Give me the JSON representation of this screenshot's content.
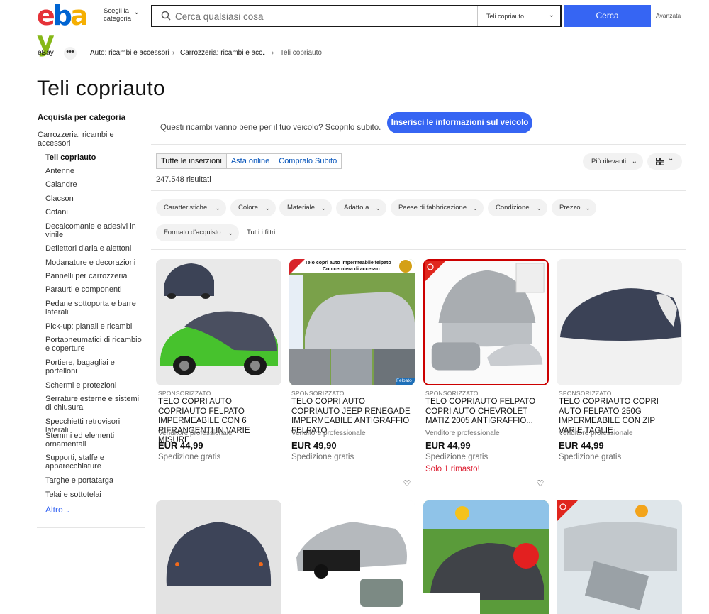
{
  "header": {
    "logo": [
      "e",
      "b",
      "a",
      "y"
    ],
    "category_select": "Scegli la categoria",
    "search_placeholder": "Cerca qualsiasi cosa",
    "search_category": "Teli copriauto",
    "search_button": "Cerca",
    "advanced": "Avanzata"
  },
  "breadcrumb": [
    "eBay",
    "•••",
    "Auto: ricambi e accessori",
    "Carrozzeria: ricambi e acc...",
    "Teli copriauto"
  ],
  "page_title": "Teli copriauto",
  "sidebar": {
    "heading": "Acquista per categoria",
    "parent": "Carrozzeria: ricambi e accessori",
    "items": [
      "Teli copriauto",
      "Antenne",
      "Calandre",
      "Clacson",
      "Cofani",
      "Decalcomanie e adesivi in vinile",
      "Deflettori d'aria e alettoni",
      "Modanature e decorazioni",
      "Pannelli per carrozzeria",
      "Paraurti e componenti",
      "Pedane sottoporta e barre laterali",
      "Pick-up: pianali e ricambi",
      "Portapneumatici di ricambio e coperture",
      "Portiere, bagagliai e portelloni",
      "Schermi e protezioni",
      "Serrature esterne e sistemi di chiusura",
      "Specchietti retrovisori laterali",
      "Stemmi ed elementi ornamentali",
      "Supporti, staffe e apparecchiature",
      "Targhe e portatarga",
      "Telai e sottotelai"
    ],
    "more": "Altro"
  },
  "vehicle": {
    "question": "Questi ricambi vanno bene per il tuo veicolo? Scoprilo subito.",
    "button": "Inserisci le informazioni sul veicolo"
  },
  "tabs": [
    "Tutte le inserzioni",
    "Asta online",
    "Compralo Subito"
  ],
  "results": "247.548 risultati",
  "sort": "Più rilevanti",
  "filters": [
    "Caratteristiche",
    "Colore",
    "Materiale",
    "Adatto a",
    "Paese di fabbricazione",
    "Condizione",
    "Prezzo",
    "Formato d'acquisto"
  ],
  "all_filters": "Tutti i filtri",
  "products": [
    {
      "sponsored": "SPONSORIZZATO",
      "title": "TELO COPRI AUTO COPRIAUTO FELPATO IMPERMEABILE CON 6 RIFRANGENTI IN VARIE MISURE",
      "seller": "Venditore professionale",
      "price": "EUR 44,99",
      "shipping": "Spedizione gratis",
      "stock": ""
    },
    {
      "sponsored": "SPONSORIZZATO",
      "title": "TELO COPRI AUTO COPRIAUTO JEEP RENEGADE IMPERMEABILE ANTIGRAFFIO FELPATO",
      "seller": "Venditore professionale",
      "price": "EUR 49,90",
      "shipping": "Spedizione gratis",
      "stock": "",
      "img_banner": "Telo copri auto impermeabile felpato",
      "img_banner2": "Con cerniera di accesso",
      "img_tag": "Felpato"
    },
    {
      "sponsored": "SPONSORIZZATO",
      "title": "TELO COPRIAUTO FELPATO COPRI AUTO CHEVROLET MATIZ 2005 ANTIGRAFFIO...",
      "seller": "Venditore professionale",
      "price": "EUR 44,99",
      "shipping": "Spedizione gratis",
      "stock": "Solo 1 rimasto!"
    },
    {
      "sponsored": "SPONSORIZZATO",
      "title": "TELO COPRIAUTO COPRI AUTO FELPATO 250G IMPERMEABILE CON ZIP VARIE TAGLIE",
      "seller": "Venditore professionale",
      "price": "EUR 44,99",
      "shipping": "Spedizione gratis",
      "stock": ""
    }
  ],
  "colors": {
    "accent": "#3665f3",
    "logo": [
      "#e53238",
      "#0064d2",
      "#f5af02",
      "#86b817"
    ],
    "stock": "#dd1e31"
  }
}
